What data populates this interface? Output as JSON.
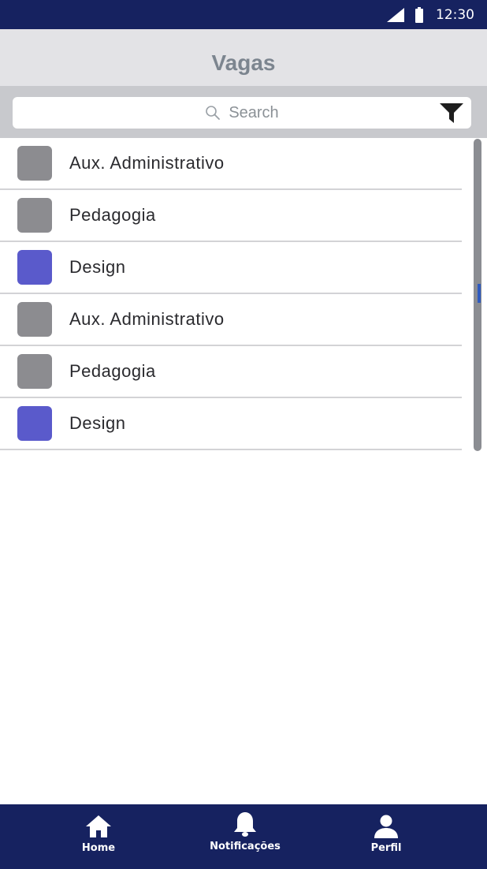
{
  "status_bar": {
    "time": "12:30",
    "signal_icon": "signal-icon",
    "battery_icon": "battery-icon"
  },
  "header": {
    "title": "Vagas"
  },
  "search": {
    "placeholder": "Search",
    "search_icon": "search-icon",
    "filter_icon": "filter-icon"
  },
  "list": {
    "items": [
      {
        "label": "Aux. Administrativo",
        "color": "#8c8c90"
      },
      {
        "label": "Pedagogia",
        "color": "#8c8c90"
      },
      {
        "label": "Design",
        "color": "#5a5acb"
      },
      {
        "label": "Aux. Administrativo",
        "color": "#8c8c90"
      },
      {
        "label": "Pedagogia",
        "color": "#8c8c90"
      },
      {
        "label": "Design",
        "color": "#5a5acb"
      }
    ]
  },
  "bottom_nav": {
    "items": [
      {
        "label": "Home",
        "icon": "home-icon"
      },
      {
        "label": "Notificações",
        "icon": "bell-icon"
      },
      {
        "label": "Perfil",
        "icon": "user-icon"
      }
    ]
  },
  "colors": {
    "nav_background": "#162260",
    "header_background": "#e3e3e6",
    "search_strip": "#c8c9cd",
    "accent": "#5a5acb",
    "neutral_thumb": "#8c8c90"
  }
}
